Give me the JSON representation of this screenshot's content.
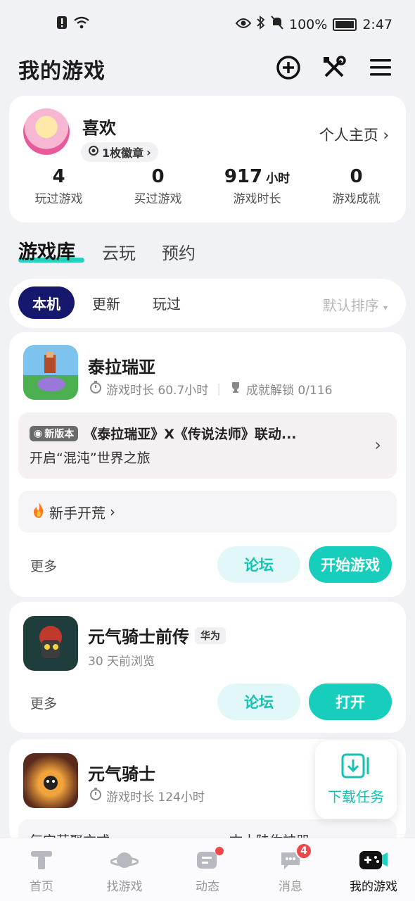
{
  "status_bar": {
    "battery": "100%",
    "time": "2:47"
  },
  "header": {
    "title": "我的游戏",
    "icons": [
      "add-circle-icon",
      "tools-icon",
      "menu-icon"
    ]
  },
  "profile": {
    "username": "喜欢",
    "badge_label": "1枚徽章",
    "homepage_link": "个人主页",
    "stats": [
      {
        "value": "4",
        "unit": "",
        "label": "玩过游戏"
      },
      {
        "value": "0",
        "unit": "",
        "label": "买过游戏"
      },
      {
        "value": "917",
        "unit": "小时",
        "label": "游戏时长"
      },
      {
        "value": "0",
        "unit": "",
        "label": "游戏成就"
      }
    ]
  },
  "main_tabs": [
    "游戏库",
    "云玩",
    "预约"
  ],
  "filters": {
    "chips": [
      "本机",
      "更新",
      "玩过"
    ],
    "sort_label": "默认排序"
  },
  "games": [
    {
      "name": "泰拉瑞亚",
      "playtime": "游戏时长 60.7小时",
      "achievements": "成就解锁 0/116",
      "news_tag": "新版本",
      "news_title": "《泰拉瑞亚》X《传说法师》联动...",
      "news_sub": "开启“混沌”世界之旅",
      "guide": "新手开荒",
      "more": "更多",
      "forum_btn": "论坛",
      "primary_btn": "开始游戏"
    },
    {
      "name": "元气骑士前传",
      "platform_tag": "华为",
      "browsed": "30 天前浏览",
      "more": "更多",
      "forum_btn": "论坛",
      "primary_btn": "打开"
    },
    {
      "name": "元气骑士",
      "playtime": "游戏时长 124小时",
      "partial_text_left": "每宝萌聚方式",
      "partial_text_right": "古士陆佐神器"
    }
  ],
  "download_fab": {
    "label": "下载任务"
  },
  "bottom_nav": [
    {
      "label": "首页",
      "icon": "home-icon"
    },
    {
      "label": "找游戏",
      "icon": "planet-icon"
    },
    {
      "label": "动态",
      "icon": "feed-icon",
      "dot": true
    },
    {
      "label": "消息",
      "icon": "message-icon",
      "badge": "4"
    },
    {
      "label": "我的游戏",
      "icon": "gamepad-icon",
      "active": true
    }
  ],
  "colors": {
    "accent": "#17cdbb",
    "active_chip": "#16186e",
    "badge_red": "#f0474a"
  }
}
